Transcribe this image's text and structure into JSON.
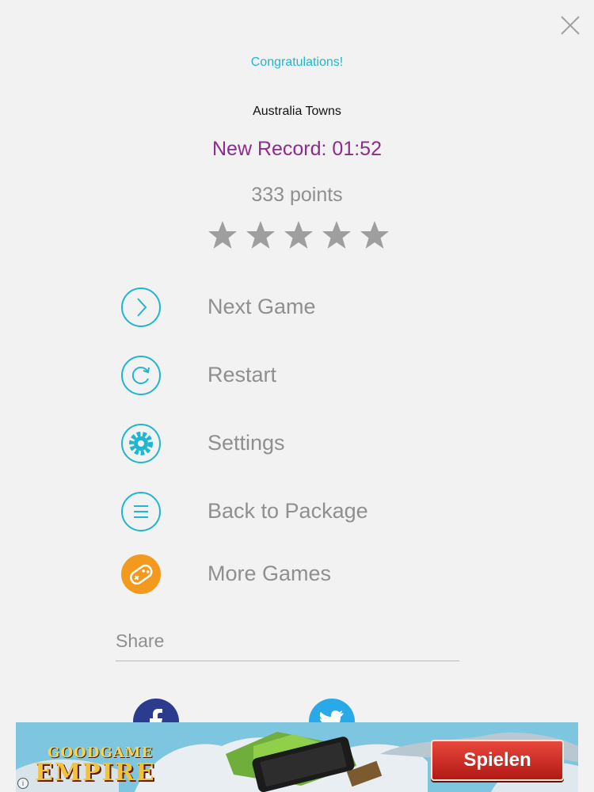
{
  "result": {
    "congratulations": "Congratulations!",
    "level_name": "Australia Towns",
    "record": "New Record: 01:52",
    "points": "333 points",
    "stars_earned": 0,
    "stars_total": 5
  },
  "menu": {
    "items": [
      {
        "label": "Next Game",
        "icon": "chevron-right-icon"
      },
      {
        "label": "Restart",
        "icon": "restart-icon"
      },
      {
        "label": "Settings",
        "icon": "gear-icon"
      },
      {
        "label": "Back to Package",
        "icon": "list-icon"
      },
      {
        "label": "More Games",
        "icon": "gamepad-icon"
      }
    ]
  },
  "share": {
    "label": "Share",
    "networks": [
      "facebook",
      "twitter"
    ]
  },
  "ad": {
    "logo_top": "GOODGAME",
    "logo_main": "EMPIRE",
    "button": "Spielen"
  },
  "colors": {
    "accent": "#1fb6cf",
    "record": "#8e2c8e",
    "muted": "#8f8f8f",
    "more_games": "#f39a1e",
    "facebook": "#2b3b8e",
    "twitter": "#29a9e8",
    "ad_button": "#c9241c"
  }
}
